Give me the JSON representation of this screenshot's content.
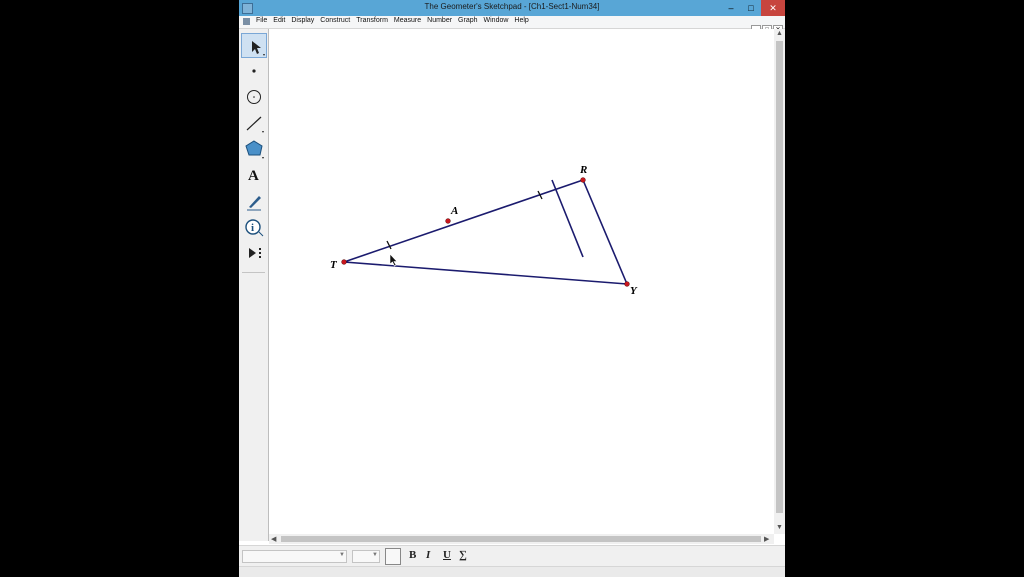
{
  "window": {
    "title": "The Geometer's Sketchpad - [Ch1-Sect1-Num34]",
    "buttons": {
      "minimize": "–",
      "maximize": "□",
      "close": "✕"
    }
  },
  "menubar": {
    "items": [
      "File",
      "Edit",
      "Display",
      "Construct",
      "Transform",
      "Measure",
      "Number",
      "Graph",
      "Window",
      "Help"
    ],
    "doc_buttons": [
      "–",
      "□",
      "✕"
    ]
  },
  "toolbox": {
    "tools": [
      "arrow-tool-icon",
      "point-tool-icon",
      "compass-tool-icon",
      "straightedge-tool-icon",
      "polygon-tool-icon",
      "text-tool-icon",
      "marker-tool-icon",
      "information-tool-icon",
      "custom-tool-icon"
    ],
    "active": "arrow-tool-icon",
    "text_tool_label": "A",
    "info_tool_label": "i"
  },
  "sketch": {
    "points": [
      {
        "name": "T",
        "label": "T"
      },
      {
        "name": "A",
        "label": "A"
      },
      {
        "name": "R",
        "label": "R"
      },
      {
        "name": "Y",
        "label": "Y"
      }
    ],
    "segments": [
      "TR",
      "RY",
      "TY"
    ],
    "colors": {
      "segment": "#1b1b6e",
      "point": "#c8161d"
    }
  },
  "textbar": {
    "bold": "B",
    "italic": "I",
    "underline": "U",
    "symbol": "∑"
  }
}
